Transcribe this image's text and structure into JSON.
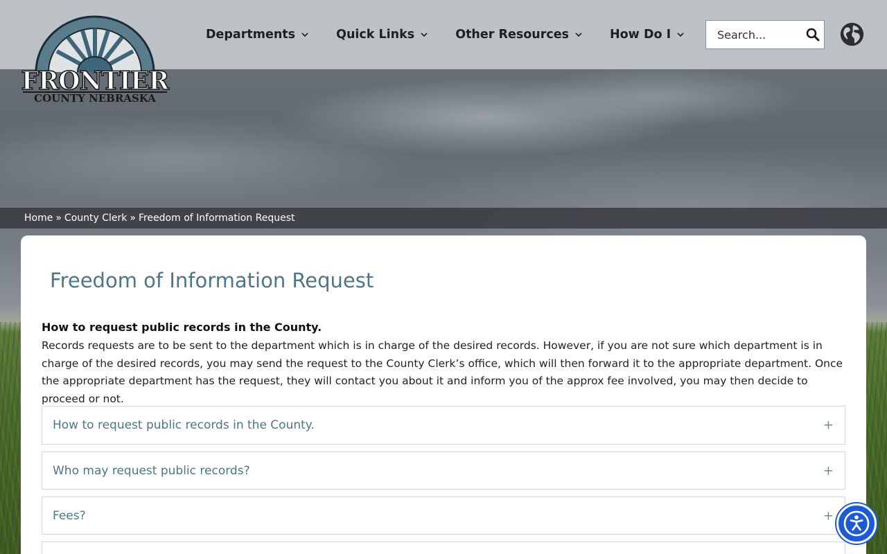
{
  "site": {
    "logo_text_main": "FRONTIER",
    "logo_text_sub": "COUNTY NEBRASKA"
  },
  "nav": {
    "items": [
      {
        "label": "Departments",
        "icon": "chevron-down-icon"
      },
      {
        "label": "Quick Links",
        "icon": "chevron-down-icon"
      },
      {
        "label": "Other Resources",
        "icon": "chevron-down-icon"
      },
      {
        "label": "How Do I",
        "icon": "chevron-down-icon"
      }
    ]
  },
  "search": {
    "placeholder": "Search...",
    "button_icon": "search-icon"
  },
  "language_icon": "globe-icon",
  "breadcrumb": {
    "items": [
      "Home",
      "County Clerk",
      "Freedom of Information Request"
    ],
    "separator": "»"
  },
  "page": {
    "title": "Freedom of Information Request",
    "intro_heading": "How to request public records in the County.",
    "intro_body": "Records requests are to be sent to the department which is in charge of the desired records. However, if you are not sure which department is in charge of the desired records, you may send the request to the County Clerk’s office, which will then forward it to the appropriate department. Once the appropriate department has the request, they will contact you about it and inform you of the approx fee involved, you may then decide to proceed or not."
  },
  "accordions": [
    {
      "title": "How to request public records in the County.",
      "icon": "+"
    },
    {
      "title": "Who may request public records?",
      "icon": "+"
    },
    {
      "title": "Fees?",
      "icon": "+"
    },
    {
      "title": "",
      "icon": ""
    }
  ],
  "accessibility_button": {
    "icon": "accessibility-icon"
  },
  "colors": {
    "title": "#4e7588",
    "accessibility": "#1c5bd6",
    "logo": "#3f6578"
  }
}
